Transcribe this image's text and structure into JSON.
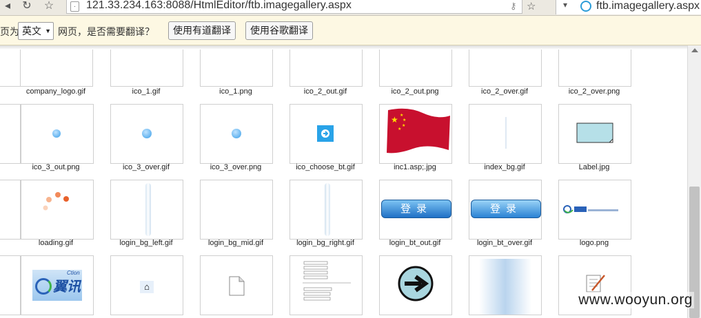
{
  "browser": {
    "address": "121.33.234.163:8088/HtmlEditor/ftb.imagegallery.aspx",
    "tab_title": "ftb.imagegallery.aspx"
  },
  "translate_bar": {
    "prefix": "页为",
    "language": "英文",
    "question": "网页，是否需要翻译？",
    "youdao_label": "使用有道翻译",
    "google_label": "使用谷歌翻译"
  },
  "gallery": {
    "rows": [
      [
        "company_logo.gif",
        "ico_1.gif",
        "ico_1.png",
        "ico_2_out.gif",
        "ico_2_out.png",
        "ico_2_over.gif",
        "ico_2_over.png"
      ],
      [
        "ico_3_out.png",
        "ico_3_over.gif",
        "ico_3_over.png",
        "ico_choose_bt.gif",
        "inc1.asp;.jpg",
        "index_bg.gif",
        "Label.jpg"
      ],
      [
        "loading.gif",
        "login_bg_left.gif",
        "login_bg_mid.gif",
        "login_bg_right.gif",
        "login_bt_out.gif",
        "login_bt_over.gif",
        "logo.png"
      ]
    ],
    "login_button_text": "登录",
    "logo_brand_text": "翼讯",
    "logo_sub_text": "Ction"
  },
  "watermark": "www.wooyun.org",
  "colors": {
    "translate_bar_bg": "#fdf8e3",
    "flag_red": "#c8102e",
    "accent_blue": "#3a9ee8"
  }
}
